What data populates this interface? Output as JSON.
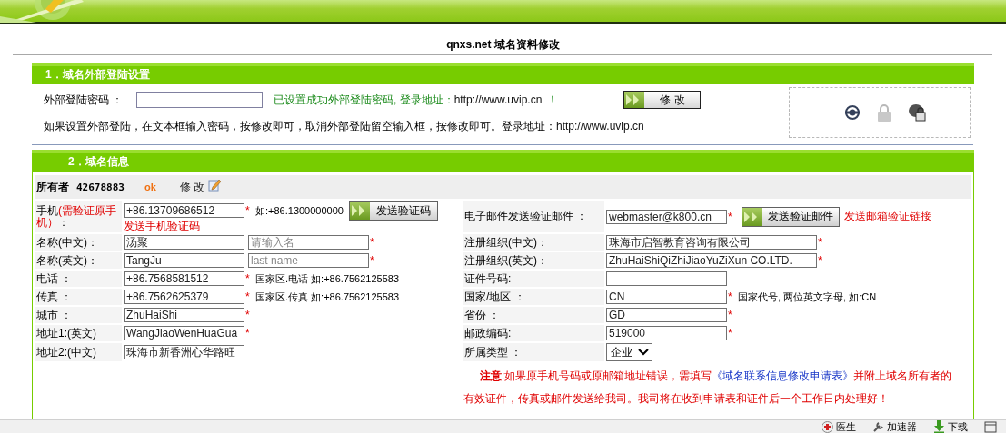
{
  "page_title": "qnxs.net 域名资料修改",
  "login_section": {
    "heading": "1．域名外部登陆设置",
    "password_label": "外部登陆密码 ：",
    "success_text": "已设置成功外部登陆密码, 登录地址：",
    "success_url": "http://www.uvip.cn",
    "success_end": "！",
    "button": "修 改",
    "help_text": "如果设置外部登陆，在文本框输入密码，按修改即可，取消外部登陆留空输入框，按修改即可。登录地址：",
    "help_url": "http://www.uvip.cn"
  },
  "info_section": {
    "heading": "2．域名信息",
    "owner_label": "所有者",
    "owner_id": "42678883",
    "owner_status": "ok",
    "edit_link": "修 改"
  },
  "left_fields": [
    {
      "kind": "text",
      "label": "手机",
      "label_note": "(需验证原手机）",
      "label_suffix": "：",
      "value": "+86.13709686512",
      "mark": "*",
      "hint": "如:+86.1300000000",
      "button": "发送验证码",
      "note": "发送手机验证码"
    },
    {
      "kind": "name_pair",
      "label": "名称(中文)：",
      "value": "汤聚",
      "second_placeholder": "请输入名",
      "mark": "*"
    },
    {
      "kind": "name_pair",
      "label": "名称(英文)：",
      "value": "TangJu",
      "second_placeholder": "last name",
      "mark": "*"
    },
    {
      "kind": "text",
      "label": "电话 ：",
      "value": "+86.7568581512",
      "mark": "*",
      "hint": "国家区.电话 如:+86.7562125583"
    },
    {
      "kind": "text",
      "label": "传真 ：",
      "value": "+86.7562625379",
      "mark": "*",
      "hint": "国家区.传真 如:+86.7562125583"
    },
    {
      "kind": "text",
      "label": "城市 ：",
      "value": "ZhuHaiShi",
      "mark": "*"
    },
    {
      "kind": "text",
      "label": "地址1:(英文)",
      "value": "WangJiaoWenHuaGua",
      "mark": "*"
    },
    {
      "kind": "text",
      "label": "地址2:(中文)",
      "value": "珠海市新香洲心华路旺"
    }
  ],
  "right_fields": [
    {
      "kind": "text",
      "label": "电子邮件发送验证邮件 ：",
      "value": "webmaster@k800.cn",
      "mark": "*",
      "button": "发送验证邮件",
      "note": "发送邮箱验证链接"
    },
    {
      "kind": "wide_text",
      "label": "注册组织(中文)：",
      "value": "珠海市启智教育咨询有限公司",
      "mark": "*"
    },
    {
      "kind": "wide_text",
      "label": "注册组织(英文)：",
      "value": "ZhuHaiShiQiZhiJiaoYuZiXun CO.LTD.",
      "mark": "*"
    },
    {
      "kind": "text",
      "label": "证件号码:"
    },
    {
      "kind": "text",
      "label": "国家/地区 ：",
      "value": "CN",
      "mark": "*",
      "hint": "国家代号, 两位英文字母, 如:CN"
    },
    {
      "kind": "text",
      "label": "省份 ：",
      "value": "GD",
      "mark": "*"
    },
    {
      "kind": "text",
      "label": "邮政编码:",
      "value": "519000",
      "mark": "*"
    },
    {
      "kind": "select",
      "label": "所属类型 ：",
      "value": "企业"
    }
  ],
  "notice": {
    "before": "**注意**:如果原手机号码或原邮箱地址错误，需填写",
    "link": "《域名联系信息修改申请表》",
    "after": "并附上域名所有者的有效证件，传真或邮件发送给我司。我司将在收到申请表和证件后一个工作日内处理好！"
  },
  "status_bar": [
    {
      "kind": "doctor",
      "label": "医生"
    },
    {
      "kind": "booster",
      "label": "加速器"
    },
    {
      "kind": "download",
      "label": "下载"
    },
    {
      "kind": "window"
    }
  ]
}
